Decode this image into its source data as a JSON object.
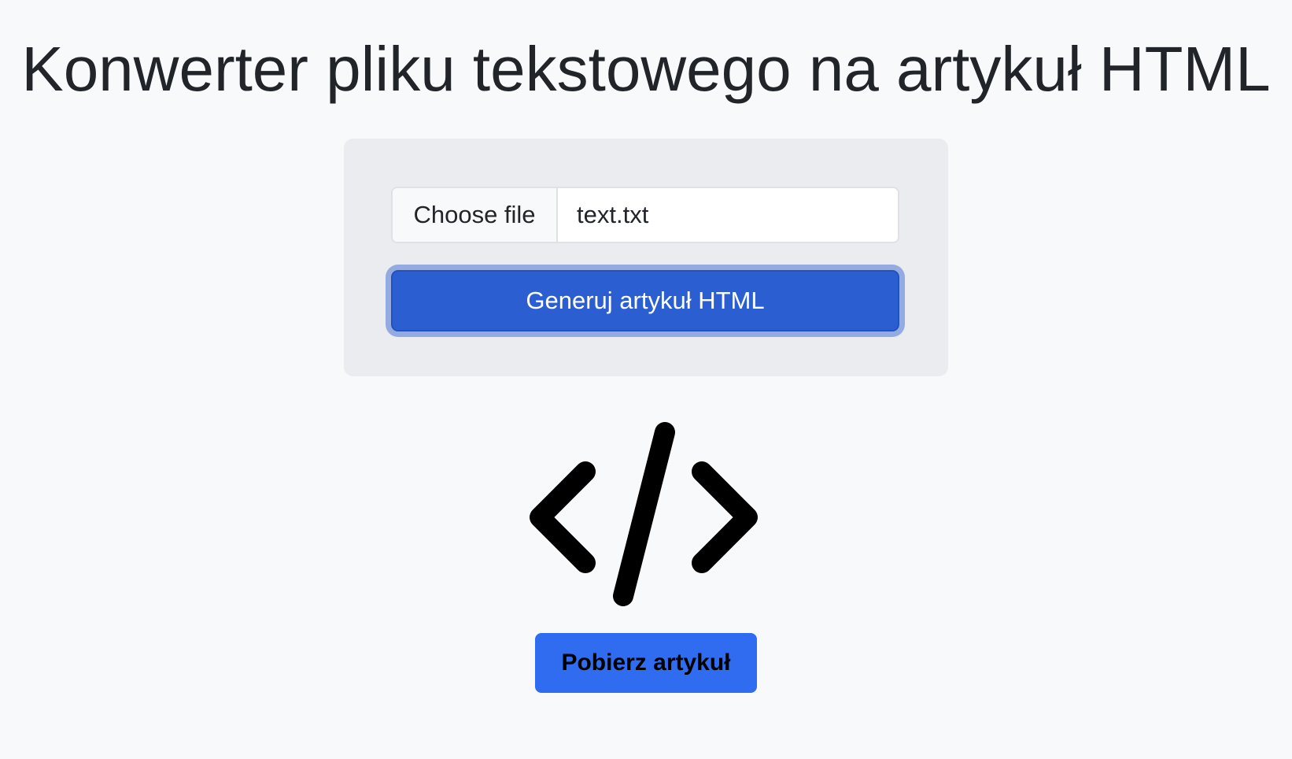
{
  "page": {
    "title": "Konwerter pliku tekstowego na artykuł HTML"
  },
  "upload": {
    "choose_file_label": "Choose file",
    "file_name": "text.txt"
  },
  "actions": {
    "generate_label": "Generuj artykuł HTML",
    "download_label": "Pobierz artykuł"
  },
  "icons": {
    "code": "code-icon"
  },
  "colors": {
    "primary_button": "#2b5ed1",
    "download_button": "#306cf0",
    "background": "#f8f9fa",
    "card": "#ebecef"
  }
}
